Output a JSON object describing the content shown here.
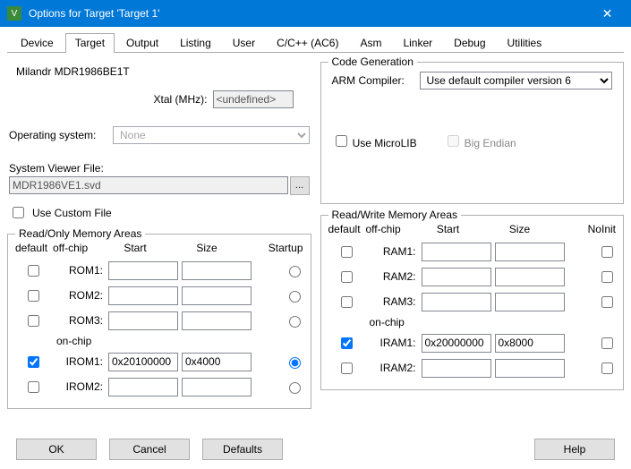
{
  "title": "Options for Target 'Target 1'",
  "tabs": [
    "Device",
    "Target",
    "Output",
    "Listing",
    "User",
    "C/C++ (AC6)",
    "Asm",
    "Linker",
    "Debug",
    "Utilities"
  ],
  "active_tab": 1,
  "device_name": "Milandr MDR1986BE1T",
  "xtal_label": "Xtal (MHz):",
  "xtal_value": "<undefined>",
  "os_label": "Operating system:",
  "os_value": "None",
  "svd_label": "System Viewer File:",
  "svd_value": "MDR1986VE1.svd",
  "use_custom_file": "Use Custom File",
  "code_gen": {
    "legend": "Code Generation",
    "arm_label": "ARM Compiler:",
    "arm_value": "Use default compiler version 6",
    "microlib": "Use MicroLIB",
    "big_endian": "Big Endian"
  },
  "romem": {
    "legend": "Read/Only Memory Areas",
    "hdr_default": "default",
    "hdr_offchip": "off-chip",
    "hdr_start": "Start",
    "hdr_size": "Size",
    "hdr_startup": "Startup",
    "onchip": "on-chip",
    "rows": [
      {
        "name": "ROM1:",
        "checked": false,
        "start": "",
        "size": "",
        "startup": false
      },
      {
        "name": "ROM2:",
        "checked": false,
        "start": "",
        "size": "",
        "startup": false
      },
      {
        "name": "ROM3:",
        "checked": false,
        "start": "",
        "size": "",
        "startup": false
      },
      {
        "name": "IROM1:",
        "checked": true,
        "start": "0x20100000",
        "size": "0x4000",
        "startup": true
      },
      {
        "name": "IROM2:",
        "checked": false,
        "start": "",
        "size": "",
        "startup": false
      }
    ]
  },
  "rwmem": {
    "legend": "Read/Write Memory Areas",
    "hdr_default": "default",
    "hdr_offchip": "off-chip",
    "hdr_start": "Start",
    "hdr_size": "Size",
    "hdr_noinit": "NoInit",
    "onchip": "on-chip",
    "rows": [
      {
        "name": "RAM1:",
        "checked": false,
        "start": "",
        "size": "",
        "noinit": false
      },
      {
        "name": "RAM2:",
        "checked": false,
        "start": "",
        "size": "",
        "noinit": false
      },
      {
        "name": "RAM3:",
        "checked": false,
        "start": "",
        "size": "",
        "noinit": false
      },
      {
        "name": "IRAM1:",
        "checked": true,
        "start": "0x20000000",
        "size": "0x8000",
        "noinit": false
      },
      {
        "name": "IRAM2:",
        "checked": false,
        "start": "",
        "size": "",
        "noinit": false
      }
    ]
  },
  "buttons": {
    "ok": "OK",
    "cancel": "Cancel",
    "defaults": "Defaults",
    "help": "Help"
  }
}
